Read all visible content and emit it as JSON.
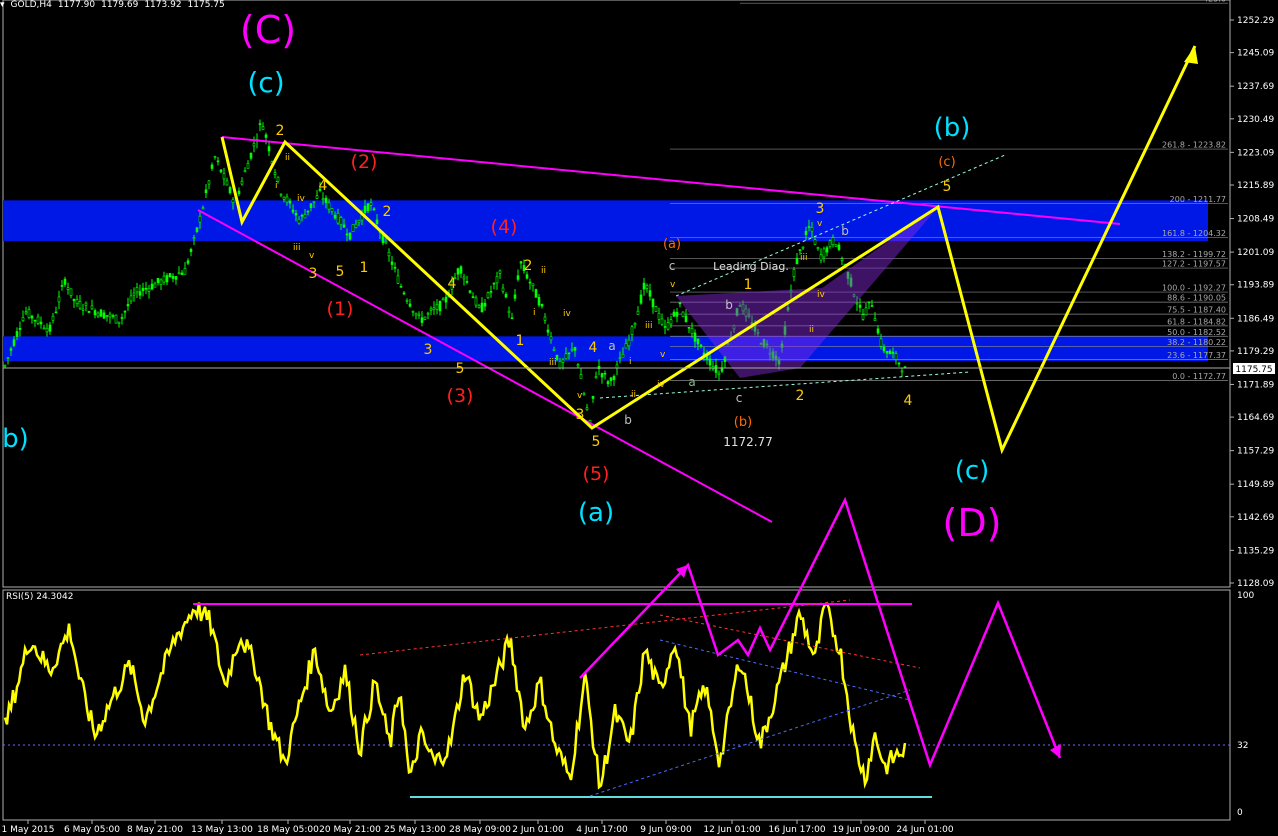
{
  "header": {
    "symbol": "GOLD,H4",
    "open": "1177.90",
    "high": "1179.69",
    "low": "1173.92",
    "close": "1175.75"
  },
  "rsi_panel": {
    "label": "RSI(5) 24.3042",
    "scale": [
      "100",
      "32",
      "0"
    ]
  },
  "current_price_label": "1175.75",
  "colors": {
    "background": "#000000",
    "candles": "#00ff00",
    "zone": "#0018e6",
    "yellow": "#ffff00",
    "magenta": "#ff00ff",
    "cyan": "#00e0ff",
    "red": "#ff2020",
    "orange": "#ff6a00",
    "rsi": "#ffff00"
  },
  "chart_data": [
    {
      "type": "candlestick",
      "title": "GOLD,H4",
      "price_axis_ticks": [
        "1252.29",
        "1245.09",
        "1237.69",
        "1230.49",
        "1223.09",
        "1215.89",
        "1208.49",
        "1201.09",
        "1193.89",
        "1186.49",
        "1179.29",
        "1171.89",
        "1164.69",
        "1157.29",
        "1149.89",
        "1142.69",
        "1135.29",
        "1128.09"
      ],
      "time_axis_ticks": [
        "1 May 2015",
        "6 May 05:00",
        "8 May 21:00",
        "13 May 13:00",
        "18 May 05:00",
        "20 May 21:00",
        "25 May 13:00",
        "28 May 09:00",
        "2 Jun 01:00",
        "4 Jun 17:00",
        "9 Jun 09:00",
        "12 Jun 01:00",
        "16 Jun 17:00",
        "19 Jun 09:00",
        "24 Jun 01:00"
      ],
      "x_pivots": [
        0,
        25,
        50,
        65,
        75,
        120,
        135,
        185,
        195,
        215,
        235,
        262,
        280,
        300,
        320,
        350,
        370,
        390,
        400,
        420,
        445,
        460,
        480,
        500,
        512,
        520,
        540,
        560,
        575,
        590,
        597,
        610,
        630,
        645,
        665,
        680,
        700,
        720,
        740,
        760,
        780,
        795,
        810,
        820,
        835,
        850,
        862,
        872,
        882,
        895,
        905
      ],
      "price_pivots": [
        1173,
        1188,
        1184,
        1195,
        1190,
        1186,
        1192,
        1197,
        1204,
        1222,
        1212,
        1230,
        1215,
        1208,
        1214,
        1205,
        1212,
        1200,
        1194,
        1186,
        1190,
        1198,
        1188,
        1196,
        1186,
        1199,
        1190,
        1176,
        1180,
        1163,
        1176,
        1172,
        1182,
        1194,
        1184,
        1189,
        1180,
        1174,
        1190,
        1182,
        1177,
        1198,
        1207,
        1200,
        1204,
        1195,
        1187,
        1190,
        1180,
        1178,
        1175
      ],
      "fibonacci_levels": [
        {
          "label": "423.6",
          "price": 1256.0
        },
        {
          "label": "261.8 - 1223.82",
          "price": 1223.82
        },
        {
          "label": "200 - 1211.77",
          "price": 1211.77
        },
        {
          "label": "161.8 - 1204.32",
          "price": 1204.32
        },
        {
          "label": "138.2 - 1199.72",
          "price": 1199.72
        },
        {
          "label": "127.2 - 1197.57",
          "price": 1197.57
        },
        {
          "label": "100.0 - 1192.27",
          "price": 1192.27
        },
        {
          "label": "88.6 - 1190.05",
          "price": 1190.05
        },
        {
          "label": "75.5 - 1187.40",
          "price": 1187.4
        },
        {
          "label": "61.8 - 1184.82",
          "price": 1184.82
        },
        {
          "label": "50.0 - 1182.52",
          "price": 1182.52
        },
        {
          "label": "38.2 - 1180.22",
          "price": 1180.22
        },
        {
          "label": "23.6 - 1177.37",
          "price": 1177.37
        },
        {
          "label": "0.0 - 1172.77",
          "price": 1172.77
        }
      ],
      "zones": [
        {
          "from": 1203.5,
          "to": 1212.5
        },
        {
          "from": 1177.0,
          "to": 1182.5
        }
      ],
      "annotations": [
        "(C)",
        "(c)",
        "2",
        "i",
        "ii",
        "iii",
        "iv",
        "v",
        "3",
        "4",
        "5",
        "1",
        "(1)",
        "(2)",
        "(3)",
        "(4)",
        "(5)",
        "(a)",
        "(b)",
        "(c)",
        "(D)",
        "(b)",
        "a",
        "b",
        "c",
        "Leading Diag.",
        "1172.77",
        "b",
        "3",
        "v",
        "iii",
        "iv",
        "ii"
      ]
    },
    {
      "type": "line",
      "title": "RSI(5) 24.3042",
      "ylim": [
        0,
        100
      ],
      "levels": [
        32
      ],
      "x_pivots": [
        0,
        15,
        30,
        50,
        70,
        80,
        95,
        110,
        130,
        145,
        160,
        175,
        195,
        210,
        225,
        240,
        255,
        270,
        285,
        300,
        315,
        330,
        345,
        360,
        375,
        390,
        400,
        410,
        420,
        435,
        450,
        465,
        480,
        495,
        510,
        525,
        540,
        555,
        570,
        585,
        600,
        615,
        630,
        645,
        660,
        675,
        690,
        705,
        720,
        740,
        760,
        780,
        800,
        815,
        825,
        840,
        855,
        865,
        875,
        885,
        895,
        905
      ],
      "values": [
        30,
        55,
        80,
        65,
        85,
        60,
        35,
        50,
        68,
        42,
        62,
        80,
        95,
        88,
        58,
        82,
        68,
        40,
        22,
        50,
        75,
        45,
        65,
        28,
        60,
        30,
        58,
        12,
        35,
        22,
        30,
        65,
        42,
        60,
        80,
        38,
        60,
        30,
        15,
        62,
        10,
        45,
        30,
        75,
        55,
        80,
        38,
        58,
        22,
        72,
        30,
        60,
        92,
        70,
        95,
        75,
        30,
        15,
        35,
        20,
        25,
        28
      ]
    }
  ]
}
